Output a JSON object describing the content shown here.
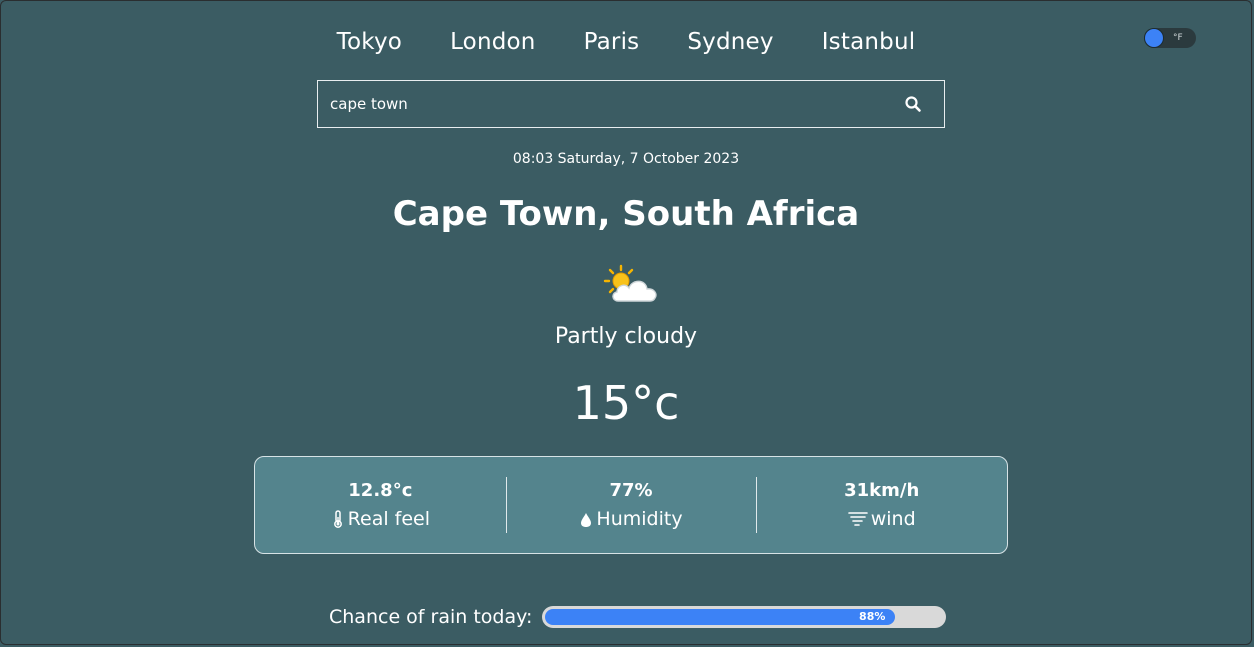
{
  "nav": {
    "cities": [
      "Tokyo",
      "London",
      "Paris",
      "Sydney",
      "Istanbul"
    ]
  },
  "unit_toggle": {
    "label": "°F",
    "knob_color": "#3c82f6"
  },
  "search": {
    "value": "cape town",
    "icon": "search-icon"
  },
  "weather": {
    "datetime": "08:03 Saturday, 7 October 2023",
    "location": "Cape Town, South Africa",
    "icon": "partly-cloudy-icon",
    "condition": "Partly cloudy",
    "temperature": "15°c"
  },
  "stats": [
    {
      "value": "12.8°c",
      "label": "Real feel",
      "icon": "thermometer-icon"
    },
    {
      "value": "77%",
      "label": "Humidity",
      "icon": "droplet-icon"
    },
    {
      "value": "31km/h",
      "label": "wind",
      "icon": "tornado-icon"
    }
  ],
  "rain": {
    "label": "Chance of rain today:",
    "percent_text": "88%",
    "fraction": 0.88,
    "fill_color": "#3c82f6"
  },
  "colors": {
    "background": "#3b5c63",
    "panel": "#54848d",
    "accent": "#3c82f6"
  }
}
